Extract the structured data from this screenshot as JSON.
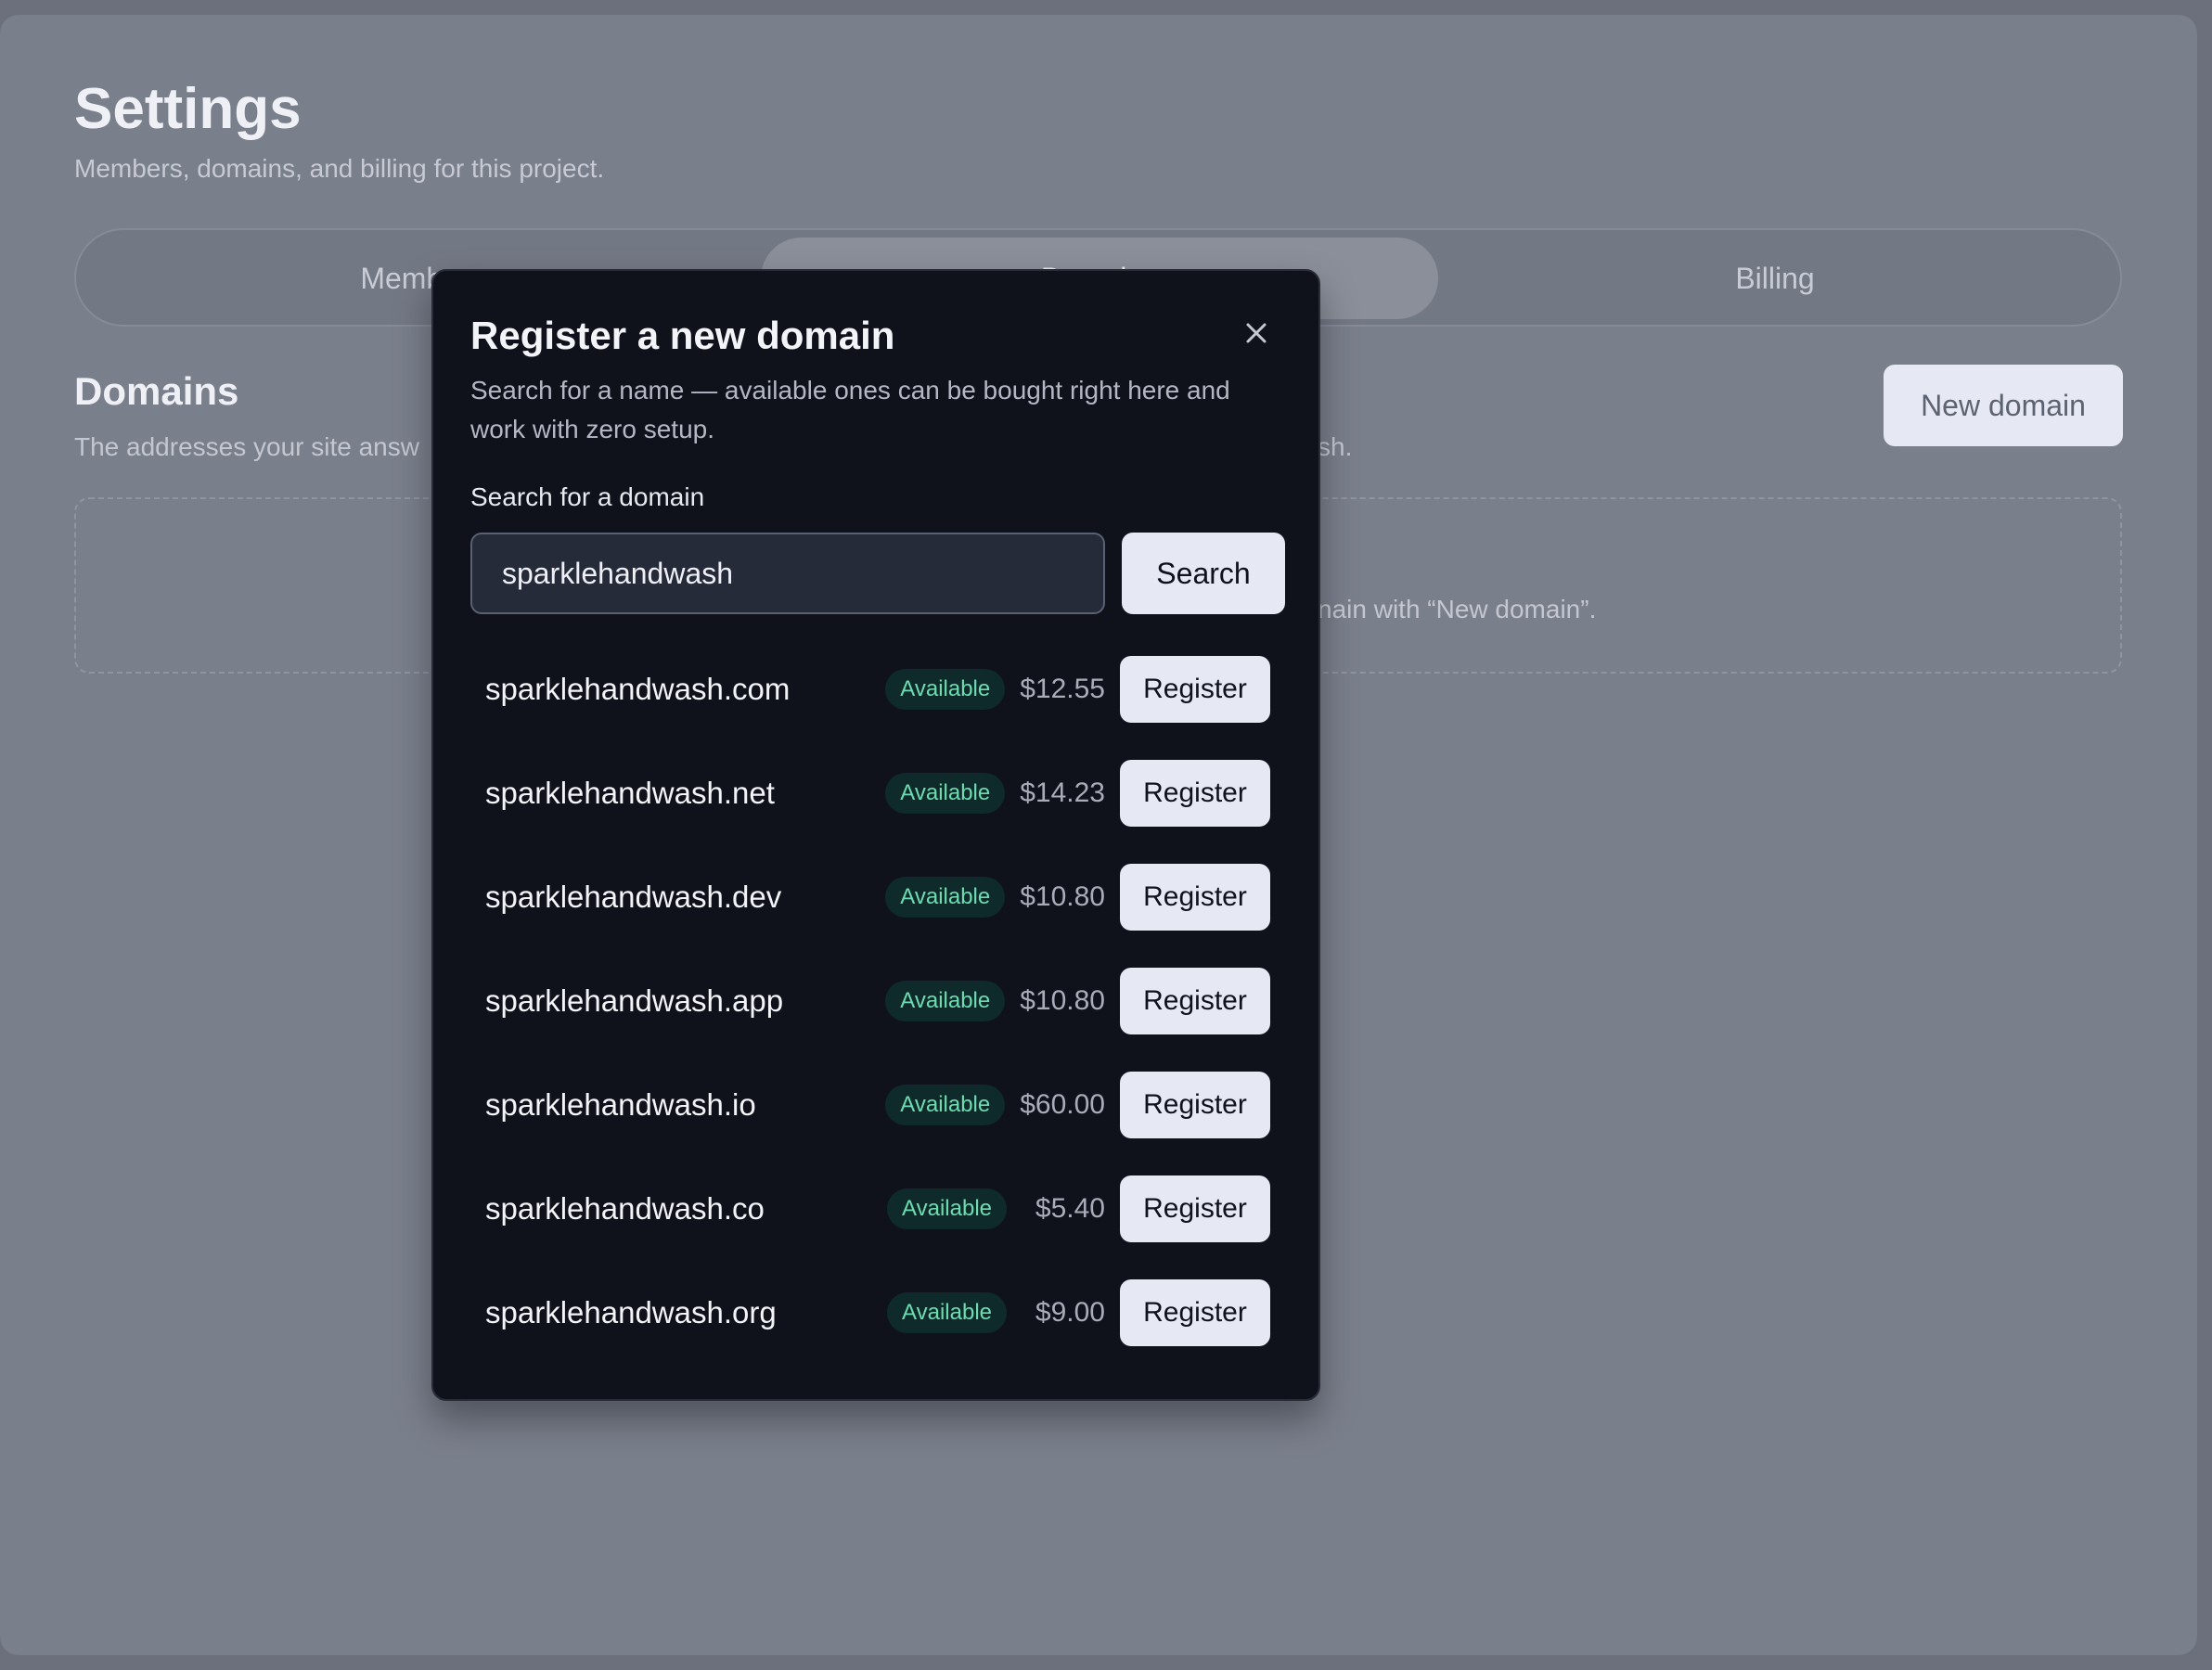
{
  "page": {
    "title": "Settings",
    "subtitle": "Members, domains, and billing for this project."
  },
  "tabs": [
    {
      "label": "Members"
    },
    {
      "label": "Domains",
      "active": true
    },
    {
      "label": "Billing"
    }
  ],
  "domains_section": {
    "heading": "Domains",
    "description_start": "The addresses your site answ",
    "description_tail": "sh.",
    "new_domain_label": "New domain",
    "empty_text_visible": "nain with “New domain”."
  },
  "modal": {
    "title": "Register a new domain",
    "description": "Search for a name — available ones can be bought right here and work with zero setup.",
    "search_label": "Search for a domain",
    "search_value": "sparklehandwash",
    "search_button": "Search",
    "close_icon": "close-icon",
    "results": [
      {
        "domain": "sparklehandwash.com",
        "status": "Available",
        "price": "$12.55",
        "action": "Register"
      },
      {
        "domain": "sparklehandwash.net",
        "status": "Available",
        "price": "$14.23",
        "action": "Register"
      },
      {
        "domain": "sparklehandwash.dev",
        "status": "Available",
        "price": "$10.80",
        "action": "Register"
      },
      {
        "domain": "sparklehandwash.app",
        "status": "Available",
        "price": "$10.80",
        "action": "Register"
      },
      {
        "domain": "sparklehandwash.io",
        "status": "Available",
        "price": "$60.00",
        "action": "Register"
      },
      {
        "domain": "sparklehandwash.co",
        "status": "Available",
        "price": "$5.40",
        "action": "Register"
      },
      {
        "domain": "sparklehandwash.org",
        "status": "Available",
        "price": "$9.00",
        "action": "Register"
      }
    ]
  },
  "colors": {
    "overlay_bg": "#7a7f8c",
    "modal_bg": "#0f111b",
    "badge_text": "#6ddcb0",
    "badge_bg": "#0f2a2a",
    "button_bg": "#e6e9f4"
  }
}
